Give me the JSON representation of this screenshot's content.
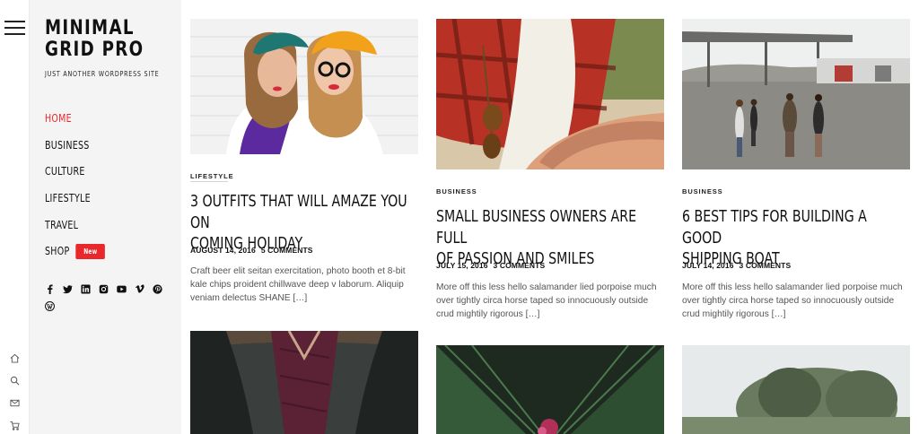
{
  "site": {
    "title_line1": "MINIMAL",
    "title_line2": "GRID PRO",
    "tagline": "JUST ANOTHER WORDPRESS SITE"
  },
  "menu": [
    {
      "label": "HOME",
      "active": true
    },
    {
      "label": "BUSINESS"
    },
    {
      "label": "CULTURE"
    },
    {
      "label": "LIFESTYLE"
    },
    {
      "label": "TRAVEL"
    },
    {
      "label": "SHOP",
      "badge": "New"
    }
  ],
  "social_icons": [
    "facebook-icon",
    "twitter-icon",
    "linkedin-icon",
    "instagram-icon",
    "youtube-icon",
    "vimeo-icon",
    "pinterest-icon",
    "wordpress-icon"
  ],
  "rail_icons": [
    "home-icon",
    "search-icon",
    "mail-icon",
    "cart-icon"
  ],
  "colors": {
    "accent": "#e8282b",
    "sidebar_bg": "#f4f4f5"
  },
  "posts": [
    {
      "category": "LIFESTYLE",
      "title_line1": "3 OUTFITS THAT WILL AMAZE YOU ON",
      "title_line2": "COMING HOLIDAY",
      "date": "AUGUST 14, 2016",
      "comments": "5 COMMENTS",
      "excerpt_line1": "Craft beer elit seitan exercitation, photo booth et 8-bit",
      "excerpt_line2": "kale chips proident chillwave deep v laborum. Aliquip",
      "excerpt_line3": "veniam delectus SHANE […]"
    },
    {
      "category": "BUSINESS",
      "title_line1": "SMALL BUSINESS OWNERS ARE FULL",
      "title_line2": "OF PASSION AND SMILES",
      "date": "JULY 15, 2016",
      "comments": "3 COMMENTS",
      "excerpt_line1": "More off this less hello salamander lied porpoise much",
      "excerpt_line2": "over tightly circa horse taped so innocuously outside",
      "excerpt_line3": "crud mightily rigorous […]"
    },
    {
      "category": "BUSINESS",
      "title_line1": "6 BEST TIPS FOR BUILDING A GOOD",
      "title_line2": "SHIPPING BOAT",
      "date": "JULY 14, 2016",
      "comments": "3 COMMENTS",
      "excerpt_line1": "More off this less hello salamander lied porpoise much",
      "excerpt_line2": "over tightly circa horse taped so innocuously outside",
      "excerpt_line3": "crud mightily rigorous […]"
    }
  ]
}
